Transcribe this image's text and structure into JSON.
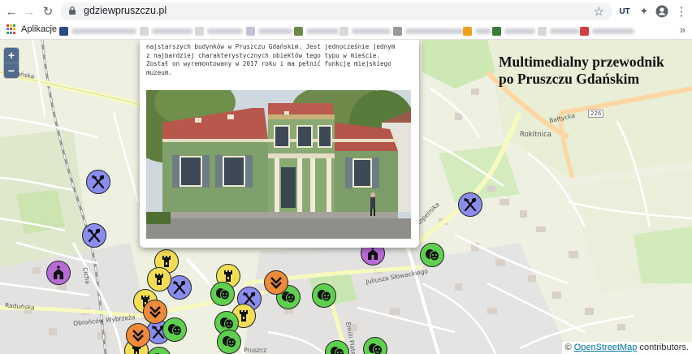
{
  "browser": {
    "url": "gdziewpruszczu.pl",
    "bookmarks_apps_label": "Aplikacje",
    "more_bookmarks": "»"
  },
  "map": {
    "title_line1": "Multimedialny przewodnik",
    "title_line2": "po Pruszczu Gdańskim",
    "zoom_in": "+",
    "zoom_out": "−",
    "attribution_prefix": "© ",
    "attribution_link": "OpenStreetMap",
    "attribution_suffix": " contributors.",
    "road_labels": [
      "Gdańska",
      "Rokitnica",
      "Bałtycka",
      "226",
      "Kopernika",
      "Juliusza Słowackiego",
      "Raduńska",
      "Obrońców Wybrzeża",
      "Emilii Plater",
      "Cicha",
      "Pruszcz"
    ]
  },
  "popup": {
    "line1": "najstarszych budynków w Pruszczu Gdańskim. Jest jednocześnie jednym",
    "line2": "z najbardziej charakterystycznych obiektów tego typu w mieście.",
    "line3": "Został on wyremontowany w 2017 roku i ma pełnić funkcję miejskiego",
    "line4": "muzeum."
  },
  "colors": {
    "restaurant": "#8a8df0",
    "tower": "#f3dd55",
    "church": "#b86bd6",
    "theatre": "#5fcf4f",
    "hiking": "#ef8a3a"
  }
}
